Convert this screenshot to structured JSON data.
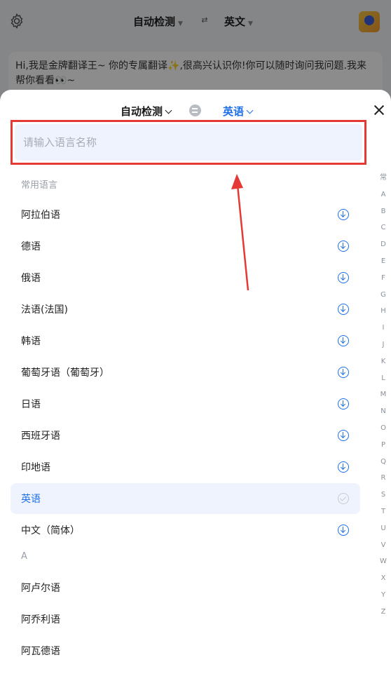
{
  "background": {
    "source_lang": "自动检测",
    "target_lang": "英文",
    "swap_glyph": "⇄",
    "bubble_text": "Hi,我是金牌翻译王~ 你的专属翻译✨,很高兴认识你!你可以随时询问我问题.我来帮你看看👀~"
  },
  "sheet": {
    "source_lang": "自动检测",
    "target_lang": "英语",
    "search_placeholder": "请输入语言名称",
    "section_common": "常用语言",
    "common_languages": [
      {
        "label": "阿拉伯语",
        "state": "download"
      },
      {
        "label": "德语",
        "state": "download"
      },
      {
        "label": "俄语",
        "state": "download"
      },
      {
        "label": "法语(法国)",
        "state": "download"
      },
      {
        "label": "韩语",
        "state": "download"
      },
      {
        "label": "葡萄牙语（葡萄牙）",
        "state": "download"
      },
      {
        "label": "日语",
        "state": "download"
      },
      {
        "label": "西班牙语",
        "state": "download"
      },
      {
        "label": "印地语",
        "state": "download"
      },
      {
        "label": "英语",
        "state": "selected"
      },
      {
        "label": "中文（简体）",
        "state": "download"
      }
    ],
    "section_a": "A",
    "a_languages": [
      {
        "label": "阿卢尔语"
      },
      {
        "label": "阿乔利语"
      },
      {
        "label": "阿瓦德语"
      }
    ],
    "index_letters": [
      "常",
      "A",
      "B",
      "C",
      "D",
      "E",
      "F",
      "G",
      "H",
      "I",
      "J",
      "K",
      "L",
      "M",
      "N",
      "O",
      "P",
      "Q",
      "R",
      "S",
      "T",
      "U",
      "V",
      "W",
      "X",
      "Y",
      "Z"
    ]
  },
  "colors": {
    "accent": "#1e6fe8",
    "highlight_box": "#e53935",
    "selected_row_bg": "#eef3fd"
  }
}
